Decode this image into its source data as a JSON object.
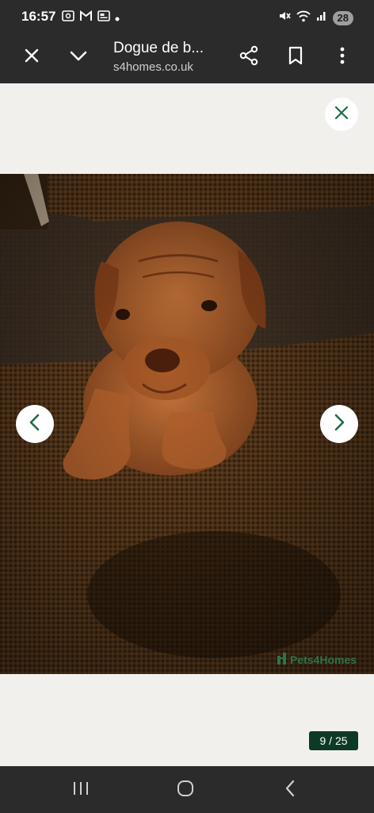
{
  "status_bar": {
    "time": "16:57",
    "battery": "28",
    "left_icons": [
      "screenshot-icon",
      "gmail-icon",
      "news-icon",
      "notification-dot-icon"
    ],
    "right_icons": [
      "mute-icon",
      "wifi-icon",
      "signal-icon"
    ]
  },
  "toolbar": {
    "title": "Dogue de b...",
    "url": "s4homes.co.uk",
    "icons": [
      "close-icon",
      "chevron-down-icon",
      "share-icon",
      "bookmark-icon",
      "more-vert-icon"
    ]
  },
  "gallery": {
    "counter": "9 / 25",
    "watermark": "Pets4Homes",
    "image_subject": "dogue-de-bordeaux-puppy-on-sofa",
    "accent_color": "#2e7d4f",
    "counter_bg": "#0d3a26"
  },
  "nav_bar": {
    "icons": [
      "recents-icon",
      "home-icon",
      "back-icon"
    ]
  }
}
